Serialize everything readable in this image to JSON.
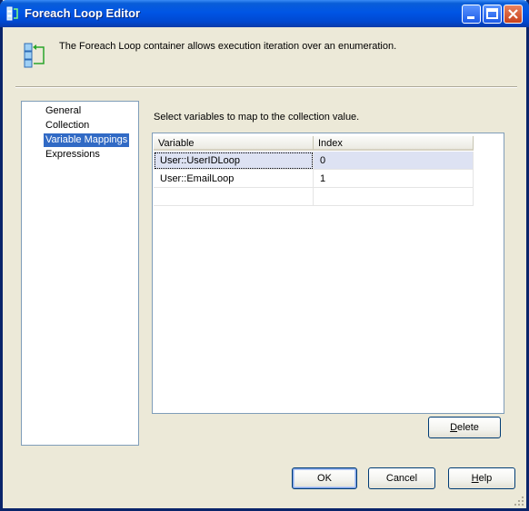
{
  "window": {
    "title": "Foreach Loop Editor"
  },
  "header": {
    "description": "The Foreach Loop container allows execution iteration over an enumeration."
  },
  "nav": {
    "items": [
      "General",
      "Collection",
      "Variable Mappings",
      "Expressions"
    ],
    "selected": "Variable Mappings"
  },
  "mappings": {
    "instruction": "Select variables to map to the collection value.",
    "columns": [
      "Variable",
      "Index"
    ],
    "rows": [
      {
        "variable": "User::UserIDLoop",
        "index": "0"
      },
      {
        "variable": "User::EmailLoop",
        "index": "1"
      }
    ]
  },
  "buttons": {
    "delete_first": "D",
    "delete_rest": "elete",
    "ok": "OK",
    "cancel": "Cancel",
    "help_first": "H",
    "help_rest": "elp"
  },
  "colors": {
    "title_bar": "#0055e5",
    "selection": "#316ac5",
    "row_selected": "#dde2f3",
    "dialog_bg": "#ece9d8"
  }
}
